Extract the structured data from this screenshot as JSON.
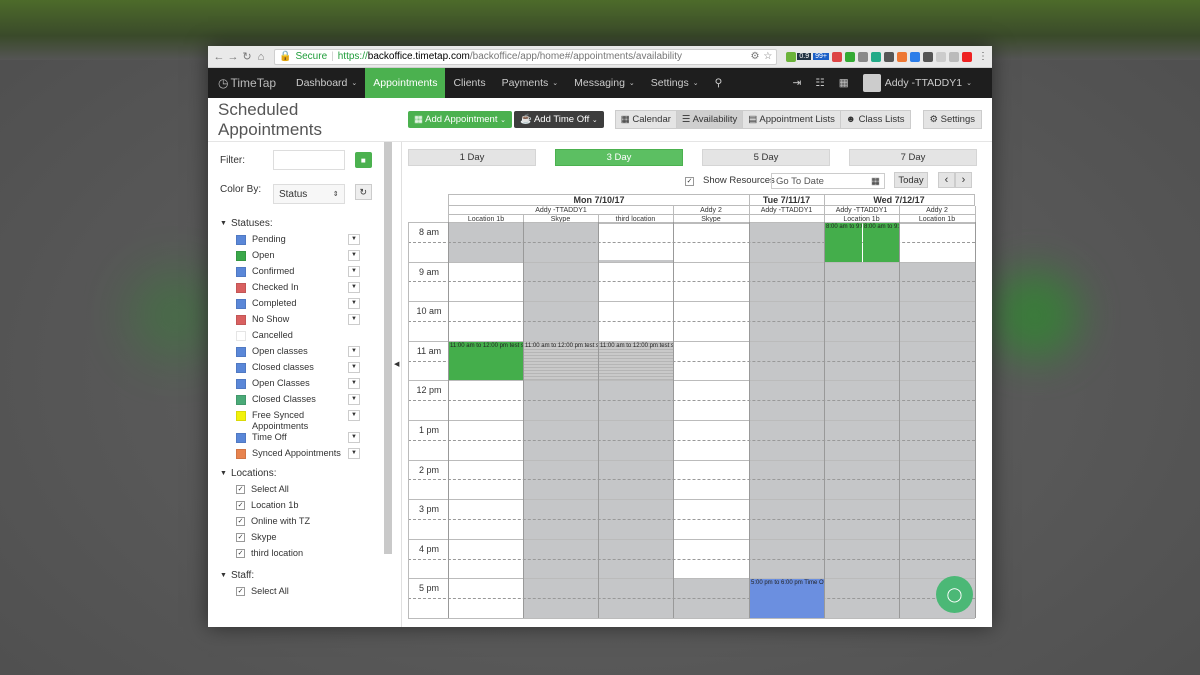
{
  "browser": {
    "secure_label": "Secure",
    "url_scheme": "https://",
    "url_host": "backoffice.timetap.com",
    "url_path": "/backoffice/app/home#/appointments/availability",
    "badge_1": "0.9",
    "badge_2": "99+"
  },
  "nav": {
    "logo": "TimeTap",
    "items": [
      {
        "label": "Dashboard",
        "dropdown": true
      },
      {
        "label": "Appointments",
        "dropdown": false,
        "active": true
      },
      {
        "label": "Clients",
        "dropdown": false
      },
      {
        "label": "Payments",
        "dropdown": true
      },
      {
        "label": "Messaging",
        "dropdown": true
      },
      {
        "label": "Settings",
        "dropdown": true
      }
    ],
    "user": "Addy -TTADDY1"
  },
  "header": {
    "title": "Scheduled Appointments",
    "add_appointment": "Add Appointment",
    "add_time_off": "Add Time Off",
    "views": [
      "Calendar",
      "Availability",
      "Appointment Lists",
      "Class Lists"
    ],
    "active_view": "Availability",
    "settings": "Settings"
  },
  "sidebar": {
    "filter_label": "Filter:",
    "color_label": "Color By:",
    "color_value": "Status",
    "statuses_label": "Statuses:",
    "statuses": [
      {
        "label": "Pending",
        "color": "#5a87d8",
        "dropdown": true
      },
      {
        "label": "Open",
        "color": "#3aa84a",
        "dropdown": true
      },
      {
        "label": "Confirmed",
        "color": "#5a87d8",
        "dropdown": true
      },
      {
        "label": "Checked In",
        "color": "#d96060",
        "dropdown": true
      },
      {
        "label": "Completed",
        "color": "#5a87d8",
        "dropdown": true
      },
      {
        "label": "No Show",
        "color": "#d96060",
        "dropdown": true
      },
      {
        "label": "Cancelled",
        "color": "#ffffff",
        "dropdown": false
      },
      {
        "label": "Open classes",
        "color": "#5a87d8",
        "dropdown": true
      },
      {
        "label": "Closed classes",
        "color": "#5a87d8",
        "dropdown": true
      },
      {
        "label": "Open Classes",
        "color": "#5a87d8",
        "dropdown": true
      },
      {
        "label": "Closed Classes",
        "color": "#4aaa78",
        "dropdown": true
      },
      {
        "label": "Free Synced Appointments",
        "color": "#f2f20a",
        "dropdown": true
      },
      {
        "label": "Time Off",
        "color": "#5a87d8",
        "dropdown": true
      },
      {
        "label": "Synced Appointments",
        "color": "#e8834e",
        "dropdown": true
      }
    ],
    "locations_label": "Locations:",
    "locations": [
      "Select All",
      "Location 1b",
      "Online with TZ",
      "Skype",
      "third location"
    ],
    "staff_label": "Staff:",
    "staff": [
      "Select All"
    ]
  },
  "calendar": {
    "day_buttons": [
      "1 Day",
      "3 Day",
      "5 Day",
      "7 Day"
    ],
    "active_day_button": "3 Day",
    "show_resources": "Show Resources",
    "goto_placeholder": "Go To Date",
    "today": "Today",
    "days": [
      "Mon 7/10/17",
      "Tue 7/11/17",
      "Wed 7/12/17"
    ],
    "staff_headers": [
      "Addy -TTADDY1",
      "Addy 2",
      "Addy -TTADDY1",
      "Addy -TTADDY1",
      "Addy 2"
    ],
    "location_headers": [
      "Location 1b",
      "Skype",
      "third location",
      "Skype",
      "",
      "Location 1b",
      "Location 1b"
    ],
    "times": [
      "8 am",
      "9 am",
      "10 am",
      "11 am",
      "12 pm",
      "1 pm",
      "2 pm",
      "3 pm",
      "4 pm",
      "5 pm"
    ],
    "events": {
      "mon_11": "11:00 am to 12:00 pm test s",
      "wed_8": "8:00 am to 9:0",
      "tue_5": "5:00 pm to 6:00 pm Time Of"
    }
  }
}
